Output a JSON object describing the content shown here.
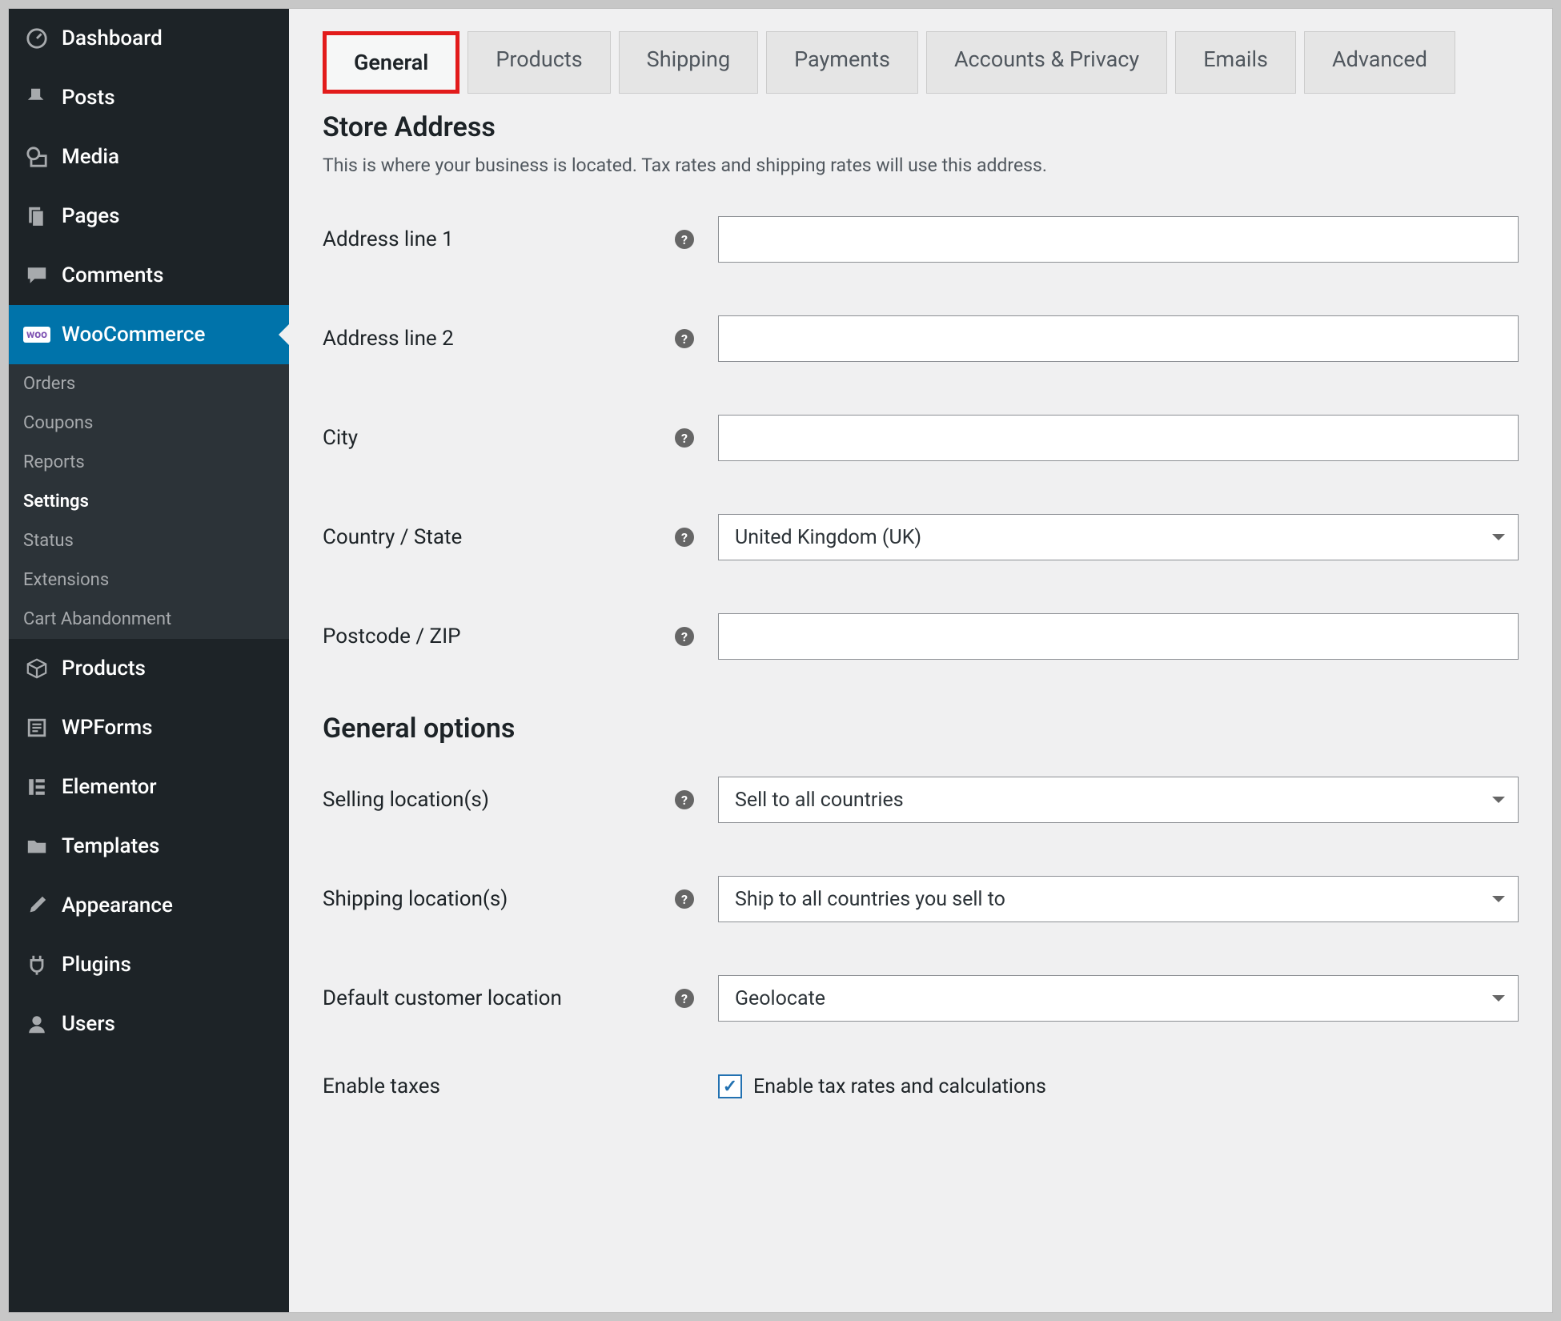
{
  "sidebar": {
    "items": [
      {
        "id": "dashboard",
        "label": "Dashboard",
        "icon": "dashboard-icon"
      },
      {
        "id": "posts",
        "label": "Posts",
        "icon": "pin-icon"
      },
      {
        "id": "media",
        "label": "Media",
        "icon": "media-icon"
      },
      {
        "id": "pages",
        "label": "Pages",
        "icon": "pages-icon"
      },
      {
        "id": "comments",
        "label": "Comments",
        "icon": "comment-icon"
      },
      {
        "id": "woocommerce",
        "label": "WooCommerce",
        "icon": "woo-icon",
        "active": true
      },
      {
        "id": "products",
        "label": "Products",
        "icon": "box-icon"
      },
      {
        "id": "wpforms",
        "label": "WPForms",
        "icon": "form-icon"
      },
      {
        "id": "elementor",
        "label": "Elementor",
        "icon": "elementor-icon"
      },
      {
        "id": "templates",
        "label": "Templates",
        "icon": "folder-icon"
      },
      {
        "id": "appearance",
        "label": "Appearance",
        "icon": "brush-icon"
      },
      {
        "id": "plugins",
        "label": "Plugins",
        "icon": "plug-icon"
      },
      {
        "id": "users",
        "label": "Users",
        "icon": "user-icon"
      }
    ],
    "submenu": [
      {
        "label": "Orders"
      },
      {
        "label": "Coupons"
      },
      {
        "label": "Reports"
      },
      {
        "label": "Settings",
        "current": true
      },
      {
        "label": "Status"
      },
      {
        "label": "Extensions"
      },
      {
        "label": "Cart Abandonment"
      }
    ],
    "woo_badge": "woo"
  },
  "tabs": [
    {
      "label": "General",
      "active": true
    },
    {
      "label": "Products"
    },
    {
      "label": "Shipping"
    },
    {
      "label": "Payments"
    },
    {
      "label": "Accounts & Privacy"
    },
    {
      "label": "Emails"
    },
    {
      "label": "Advanced"
    }
  ],
  "sections": {
    "store_address": {
      "title": "Store Address",
      "desc": "This is where your business is located. Tax rates and shipping rates will use this address.",
      "fields": {
        "address1": {
          "label": "Address line 1",
          "value": ""
        },
        "address2": {
          "label": "Address line 2",
          "value": ""
        },
        "city": {
          "label": "City",
          "value": ""
        },
        "country": {
          "label": "Country / State",
          "value": "United Kingdom (UK)"
        },
        "postcode": {
          "label": "Postcode / ZIP",
          "value": ""
        }
      }
    },
    "general_options": {
      "title": "General options",
      "fields": {
        "selling": {
          "label": "Selling location(s)",
          "value": "Sell to all countries"
        },
        "shipping": {
          "label": "Shipping location(s)",
          "value": "Ship to all countries you sell to"
        },
        "default": {
          "label": "Default customer location",
          "value": "Geolocate"
        },
        "taxes": {
          "label": "Enable taxes",
          "checkbox_label": "Enable tax rates and calculations",
          "checked": true
        }
      }
    }
  }
}
